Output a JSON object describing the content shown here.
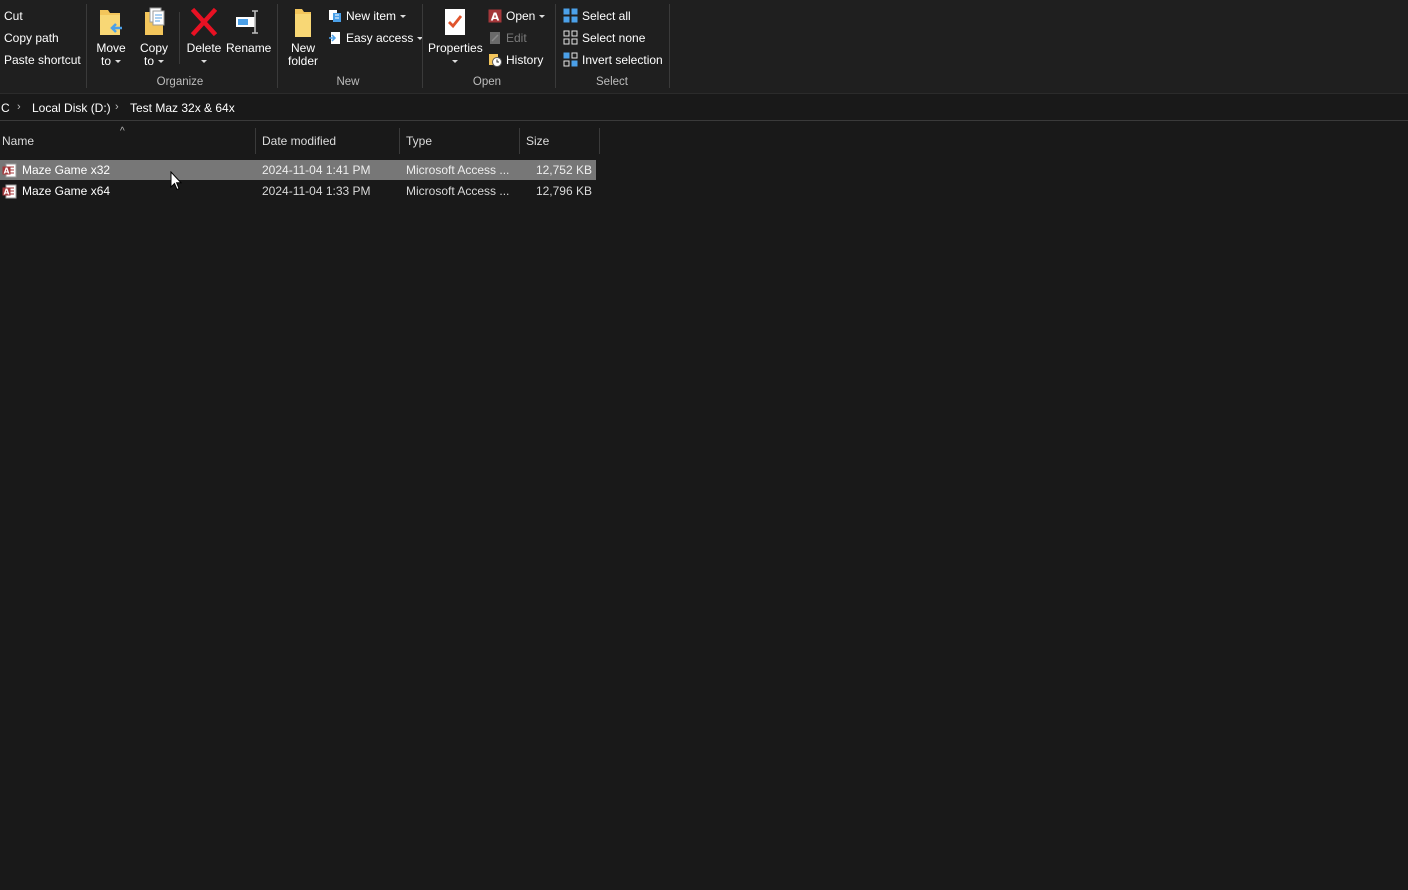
{
  "ribbon": {
    "clipboard": {
      "cut": "Cut",
      "copy_path": "Copy path",
      "paste_shortcut": "Paste shortcut"
    },
    "organize": {
      "label": "Organize",
      "move_to": [
        "Move",
        "to"
      ],
      "copy_to": [
        "Copy",
        "to"
      ],
      "delete": "Delete",
      "rename": "Rename"
    },
    "new": {
      "label": "New",
      "new_folder": [
        "New",
        "folder"
      ],
      "new_item": "New item",
      "easy_access": "Easy access"
    },
    "open": {
      "label": "Open",
      "properties": "Properties",
      "open": "Open",
      "edit": "Edit",
      "history": "History"
    },
    "select": {
      "label": "Select",
      "select_all": "Select all",
      "select_none": "Select none",
      "invert_selection": "Invert selection"
    }
  },
  "breadcrumb": {
    "items": [
      "C",
      "Local Disk (D:)",
      "Test Maz 32x & 64x"
    ]
  },
  "columns": {
    "name": "Name",
    "date_modified": "Date modified",
    "type": "Type",
    "size": "Size"
  },
  "files": [
    {
      "name": "Maze Game x32",
      "date_modified": "2024-11-04 1:41 PM",
      "type": "Microsoft Access ...",
      "size": "12,752 KB",
      "selected": true
    },
    {
      "name": "Maze Game x64",
      "date_modified": "2024-11-04 1:33 PM",
      "type": "Microsoft Access ...",
      "size": "12,796 KB",
      "selected": false
    }
  ],
  "colors": {
    "background": "#191919",
    "ribbon": "#1f1f1f",
    "selection": "#777777",
    "delete_red": "#e81123",
    "folder_yellow": "#f3c55b",
    "access_red": "#a4373a",
    "select_blue": "#4ba0e8"
  }
}
